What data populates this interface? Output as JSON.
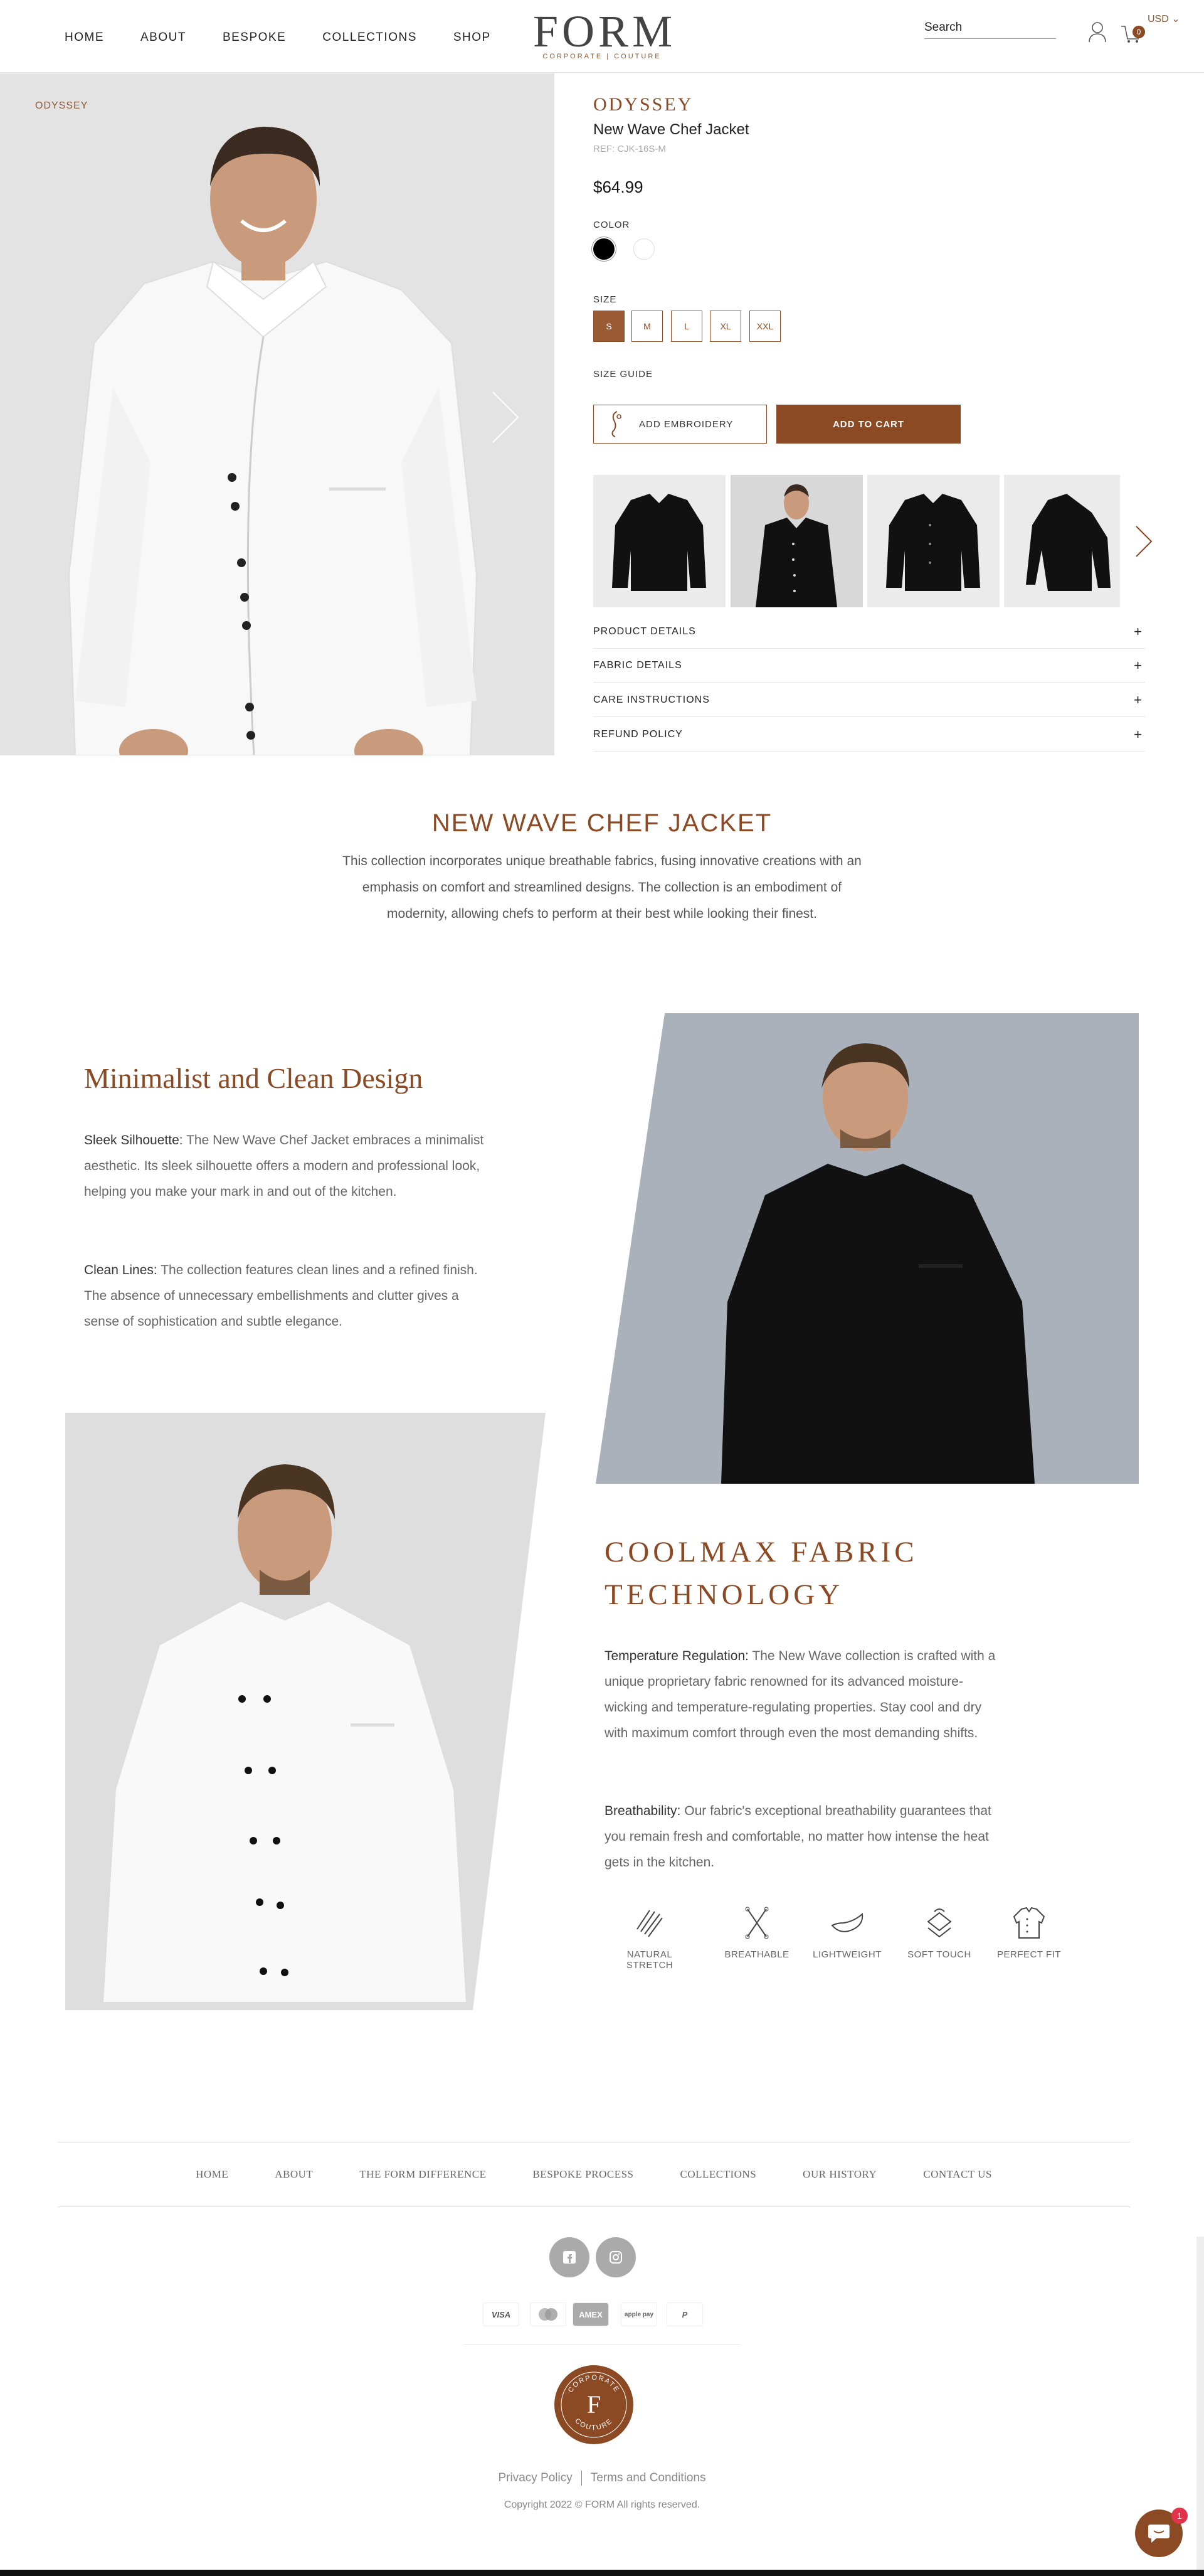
{
  "header": {
    "nav": [
      "HOME",
      "ABOUT",
      "BESPOKE",
      "COLLECTIONS",
      "SHOP"
    ],
    "logo": "FORM",
    "logo_sub": "CORPORATE | COUTURE",
    "search_placeholder": "Search",
    "currency": "USD",
    "cart_count": "0"
  },
  "hero": {
    "tag": "ODYSSEY"
  },
  "product": {
    "brand": "ODYSSEY",
    "name": "New Wave Chef Jacket",
    "ref": "REF: CJK-16S-M",
    "price": "$64.99",
    "color_label": "COLOR",
    "colors": [
      "#000000",
      "#ffffff"
    ],
    "size_label": "SIZE",
    "sizes": [
      "S",
      "M",
      "L",
      "XL",
      "XXL"
    ],
    "selected_size": "S",
    "size_guide": "SIZE GUIDE",
    "embroidery_button": "ADD EMBROIDERY",
    "cart_button": "ADD TO CART",
    "accordion": [
      "PRODUCT DETAILS",
      "FABRIC DETAILS",
      "CARE INSTRUCTIONS",
      "REFUND POLICY"
    ]
  },
  "intro": {
    "title": "NEW WAVE CHEF JACKET",
    "text": "This collection incorporates unique breathable fabrics, fusing innovative creations with an emphasis on comfort and streamlined designs. The collection is an embodiment of modernity, allowing chefs to perform at their best while looking their finest."
  },
  "feature1": {
    "title": "Minimalist and Clean Design",
    "p1_label": "Sleek Silhouette:",
    "p1_text": " The New Wave Chef Jacket embraces a minimalist aesthetic. Its sleek silhouette offers a modern and professional look, helping you make your mark in and out of the kitchen.",
    "p2_label": "Clean Lines:",
    "p2_text": " The collection features clean lines and a refined finish. The absence of unnecessary embellishments and clutter gives a sense of sophistication and subtle elegance."
  },
  "feature2": {
    "title_line1": "COOLMAX FABRIC",
    "title_line2": "TECHNOLOGY",
    "p1_label": "Temperature Regulation:",
    "p1_text": " The New Wave collection is crafted with a unique proprietary fabric renowned for its advanced moisture-wicking and temperature-regulating properties. Stay cool and dry with maximum comfort through even the most demanding shifts.",
    "p2_label": "Breathability:",
    "p2_text": " Our fabric's exceptional breathability guarantees that you remain fresh and comfortable, no matter how intense the heat gets in the kitchen.",
    "icons": [
      "NATURAL STRETCH",
      "BREATHABLE",
      "LIGHTWEIGHT",
      "SOFT TOUCH",
      "PERFECT FIT"
    ]
  },
  "footer": {
    "nav": [
      "HOME",
      "ABOUT",
      "THE FORM DIFFERENCE",
      "BESPOKE PROCESS",
      "COLLECTIONS",
      "OUR HISTORY",
      "CONTACT US"
    ],
    "payments": [
      "VISA",
      "mastercard",
      "AMEX",
      "apple pay",
      "P"
    ],
    "badge_letter": "F",
    "badge_text": "CORPORATE · COUTURE",
    "privacy": "Privacy Policy",
    "terms": "Terms and Conditions",
    "copyright": "Copyright 2022 © FORM All rights reserved.",
    "chat_count": "1"
  },
  "colors": {
    "accent": "#8b4a24",
    "muted": "#666666"
  }
}
